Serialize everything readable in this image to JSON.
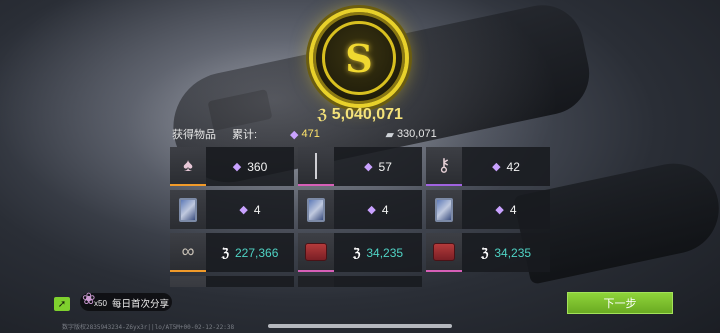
{
  "coin": {
    "emblem": "S"
  },
  "total": {
    "currency_icon": "ℨ",
    "value": "5,040,071"
  },
  "summary": {
    "obtained_label": "获得物品",
    "cumulative_label": "累计:",
    "gem_value": "471",
    "silver_value": "330,071"
  },
  "grid": {
    "cells": [
      {
        "thumb": "figure",
        "rarity": "orange",
        "kind": "gem",
        "amount": "360"
      },
      {
        "thumb": "wire",
        "rarity": "pink",
        "kind": "gem",
        "amount": "57"
      },
      {
        "thumb": "key",
        "rarity": "purple",
        "kind": "gem",
        "amount": "42"
      },
      {
        "thumb": "card",
        "rarity": "none",
        "kind": "gem",
        "amount": "4"
      },
      {
        "thumb": "card",
        "rarity": "none",
        "kind": "gem",
        "amount": "4"
      },
      {
        "thumb": "card",
        "rarity": "none",
        "kind": "gem",
        "amount": "4"
      },
      {
        "thumb": "rope",
        "rarity": "orange",
        "kind": "currency",
        "amount": "227,366"
      },
      {
        "thumb": "box",
        "rarity": "pink",
        "kind": "currency",
        "amount": "34,235"
      },
      {
        "thumb": "box",
        "rarity": "pink",
        "kind": "currency",
        "amount": "34,235"
      },
      {
        "thumb": "box",
        "rarity": "none",
        "kind": "none",
        "amount": ""
      },
      {
        "thumb": "stub",
        "rarity": "pink",
        "kind": "none",
        "amount": ""
      }
    ]
  },
  "share": {
    "count": "x50",
    "label": "每日首次分享"
  },
  "next_button": {
    "label": "下一步"
  },
  "footer": {
    "text": "数字版权2835943234-Z6yx3r||lo/AT5M+00-02-12-22:38"
  }
}
